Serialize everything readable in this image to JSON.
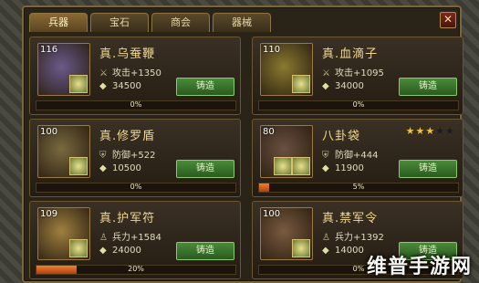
{
  "tabs": [
    {
      "label": "兵器",
      "active": true
    },
    {
      "label": "宝石",
      "active": false
    },
    {
      "label": "商会",
      "active": false
    },
    {
      "label": "器械",
      "active": false
    }
  ],
  "close_label": "✕",
  "forge_label": "铸造",
  "items": [
    {
      "level": "116",
      "name": "真.乌蚕鞭",
      "stat": "攻击+1350",
      "stat_icon": "sword-icon",
      "cost": "34500",
      "progress": "0%",
      "progress_value": 0,
      "thumb_color": "#6a5a8a"
    },
    {
      "level": "110",
      "name": "真.血滴子",
      "stat": "攻击+1095",
      "stat_icon": "sword-icon",
      "cost": "34000",
      "progress": "0%",
      "progress_value": 0,
      "thumb_color": "#8a7a30"
    },
    {
      "level": "100",
      "name": "真.修罗盾",
      "stat": "防御+522",
      "stat_icon": "shield-icon",
      "cost": "10500",
      "progress": "0%",
      "progress_value": 0,
      "thumb_color": "#7a6a40"
    },
    {
      "level": "80",
      "name": "八卦袋",
      "stat": "防御+444",
      "stat_icon": "shield-icon",
      "cost": "11900",
      "progress": "5%",
      "progress_value": 5,
      "stars_filled": "★★★",
      "stars_empty": "★★",
      "thumb_color": "#6a5040"
    },
    {
      "level": "109",
      "name": "真.护军符",
      "stat": "兵力+1584",
      "stat_icon": "soldier-icon",
      "cost": "24000",
      "progress": "20%",
      "progress_value": 20,
      "thumb_color": "#a08040"
    },
    {
      "level": "100",
      "name": "真.禁军令",
      "stat": "兵力+1392",
      "stat_icon": "soldier-icon",
      "cost": "14000",
      "progress": "0%",
      "progress_value": 0,
      "thumb_color": "#7a5a40"
    }
  ],
  "watermark": "维普手游网",
  "colors": {
    "accent": "#f0d890",
    "forge_button": "#3a7a2a",
    "progress_fill": "#e06020",
    "star_filled": "#f0c040",
    "star_empty": "#2a2a2a"
  }
}
